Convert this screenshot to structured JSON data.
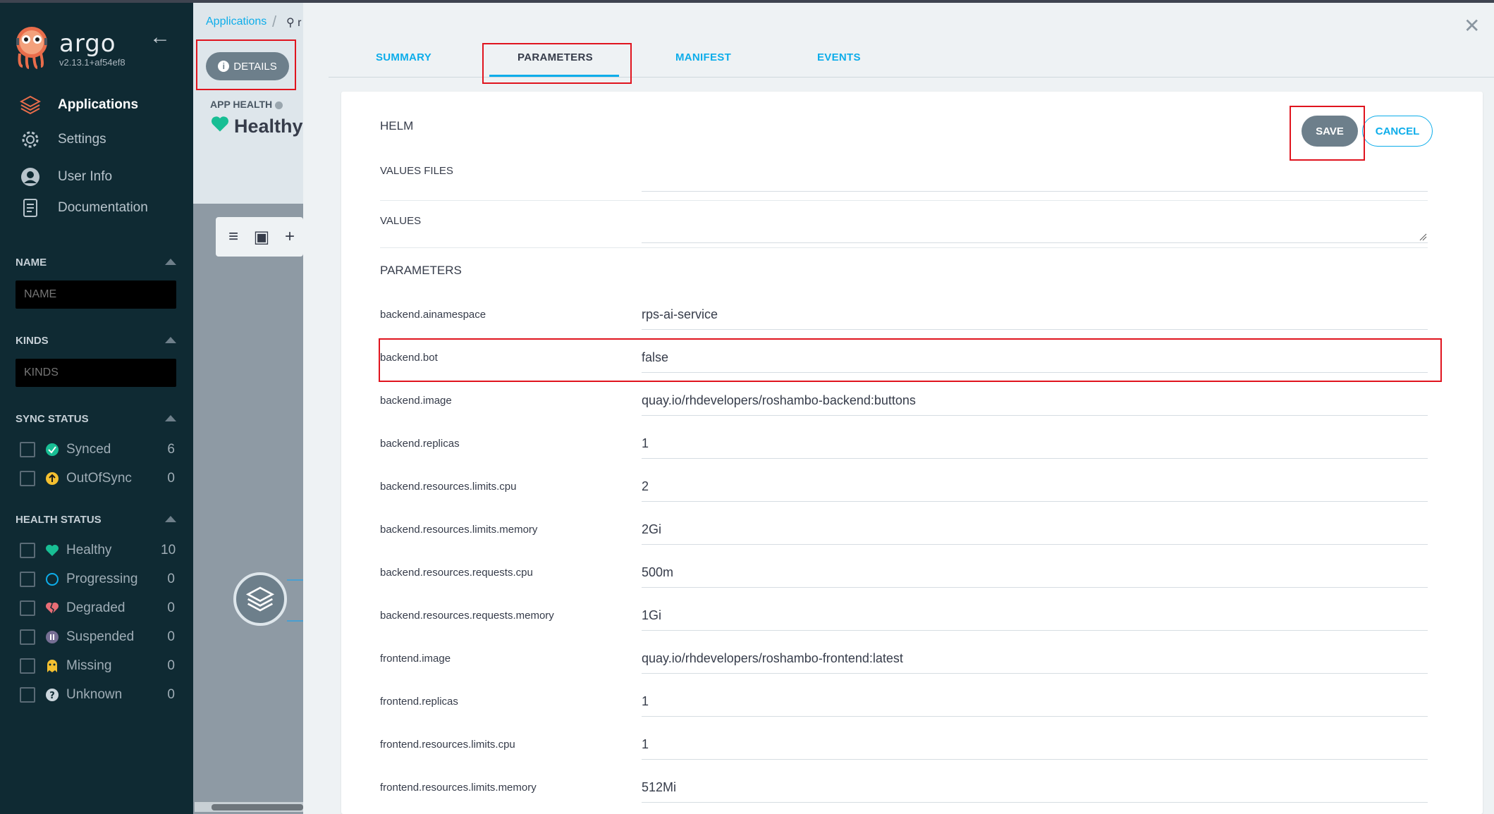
{
  "app": {
    "brand": "argo",
    "version": "v2.13.1+af54ef8"
  },
  "nav": [
    {
      "label": "Applications",
      "icon": "layers-icon",
      "active": true
    },
    {
      "label": "Settings",
      "icon": "gear-icon"
    },
    {
      "label": "User Info",
      "icon": "user-icon"
    },
    {
      "label": "Documentation",
      "icon": "document-icon"
    }
  ],
  "filters": {
    "name": {
      "title": "NAME",
      "placeholder": "NAME"
    },
    "kinds": {
      "title": "KINDS",
      "placeholder": "KINDS"
    },
    "sync_status": {
      "title": "SYNC STATUS",
      "items": [
        {
          "label": "Synced",
          "count": "6",
          "icon": "check-circle-icon",
          "color": "#18be94"
        },
        {
          "label": "OutOfSync",
          "count": "0",
          "icon": "arrow-up-circle-icon",
          "color": "#f4c030"
        }
      ]
    },
    "health_status": {
      "title": "HEALTH STATUS",
      "items": [
        {
          "label": "Healthy",
          "count": "10",
          "icon": "heart-icon",
          "color": "#18be94"
        },
        {
          "label": "Progressing",
          "count": "0",
          "icon": "circle-notch-icon",
          "color": "#0dadea"
        },
        {
          "label": "Degraded",
          "count": "0",
          "icon": "heart-broken-icon",
          "color": "#e96d76"
        },
        {
          "label": "Suspended",
          "count": "0",
          "icon": "pause-circle-icon",
          "color": "#766f94"
        },
        {
          "label": "Missing",
          "count": "0",
          "icon": "ghost-icon",
          "color": "#f4c030"
        },
        {
          "label": "Unknown",
          "count": "0",
          "icon": "question-circle-icon",
          "color": "#ccd6dd"
        }
      ]
    }
  },
  "app_view": {
    "breadcrumb": "Applications",
    "search_glyph": "r",
    "details_label": "DETAILS",
    "app_health_label": "APP HEALTH",
    "app_health_value": "Healthy"
  },
  "panel": {
    "tabs": [
      "SUMMARY",
      "PARAMETERS",
      "MANIFEST",
      "EVENTS"
    ],
    "active_tab": "PARAMETERS",
    "helm_title": "HELM",
    "save_label": "SAVE",
    "cancel_label": "CANCEL",
    "values_files_label": "VALUES FILES",
    "values_label": "VALUES",
    "parameters_title": "PARAMETERS",
    "parameters": [
      {
        "name": "backend.ainamespace",
        "value": "rps-ai-service"
      },
      {
        "name": "backend.bot",
        "value": "false"
      },
      {
        "name": "backend.image",
        "value": "quay.io/rhdevelopers/roshambo-backend:buttons"
      },
      {
        "name": "backend.replicas",
        "value": "1"
      },
      {
        "name": "backend.resources.limits.cpu",
        "value": "2"
      },
      {
        "name": "backend.resources.limits.memory",
        "value": "2Gi"
      },
      {
        "name": "backend.resources.requests.cpu",
        "value": "500m"
      },
      {
        "name": "backend.resources.requests.memory",
        "value": "1Gi"
      },
      {
        "name": "frontend.image",
        "value": "quay.io/rhdevelopers/roshambo-frontend:latest"
      },
      {
        "name": "frontend.replicas",
        "value": "1"
      },
      {
        "name": "frontend.resources.limits.cpu",
        "value": "1"
      },
      {
        "name": "frontend.resources.limits.memory",
        "value": "512Mi"
      }
    ]
  }
}
